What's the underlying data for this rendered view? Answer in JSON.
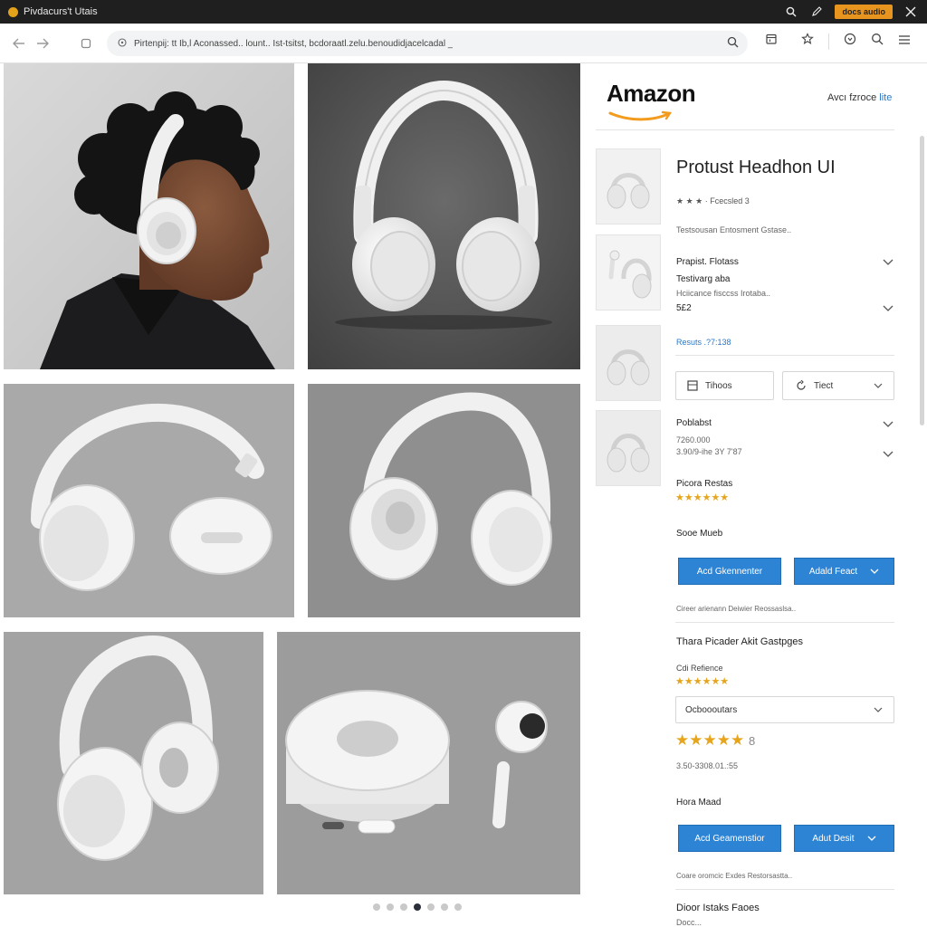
{
  "browser": {
    "tab_title": "Pivdacurs't Utais",
    "badge_label": "docs audio",
    "url": "Pirtenpij: tt Ib,l Aconassed.. lount.. Ist-tsitst, bcdoraatl.zelu.benoudidjacelcadal _"
  },
  "header": {
    "logo": "Amazon",
    "link_prefix": "Avcı fzroce",
    "link_accent": "lite"
  },
  "product": {
    "title": "Protust Headhon UI",
    "rating_text": "★ ★ ★ · Fcecsled 3",
    "meta_line": "Testsousan   Entosment  Gstase..",
    "section1": {
      "heading": "Prapist. Flotass",
      "subheading": "Testivarg aba",
      "note": "Hciicance fisccss Irotaba..",
      "price": "5£2"
    },
    "results_link": "Resuts .?7:138",
    "option_buttons": {
      "left": "Tihoos",
      "right": "Tiect"
    },
    "section2": {
      "heading": "Poblabst",
      "line1": "7260.000",
      "line2": "3.90/9-ihe 3Y 7'87"
    },
    "section3": {
      "heading": "Picora Restas",
      "stars": "★★★★★★"
    },
    "buy_block_1": {
      "heading": "Sooe Mueb",
      "primary_button": "Acd Gkennenter",
      "secondary_button": "Adald Feact",
      "foot": "Cireer arienann   Deiwier   Reossaslsa.."
    },
    "reviews": {
      "heading": "Thara Picader Akit Gastpges",
      "sublabel": "Cdi Refience",
      "stars": "★★★★★★",
      "select_value": "Ocboooutars",
      "big_stars": "★★★★★",
      "big_stars_count": "8",
      "date_line": "3.50-3308.01.:55"
    },
    "buy_block_2": {
      "heading": "Hora Maad",
      "primary_button": "Acd Geamenstior",
      "secondary_button": "Adut Desit",
      "foot": "Coare oromcic   Exdes   Restorsastta.."
    },
    "footer_heading": "Dioor Istaks Faoes",
    "footer_sub": "Docc..."
  },
  "gallery": {
    "dot_count": 7,
    "active_dot": 3
  },
  "colors": {
    "accent_blue": "#2d84d4",
    "star_gold": "#e6a51d",
    "amazon_orange": "#f29b1d",
    "titlebar_dark": "#1f1f1f"
  }
}
